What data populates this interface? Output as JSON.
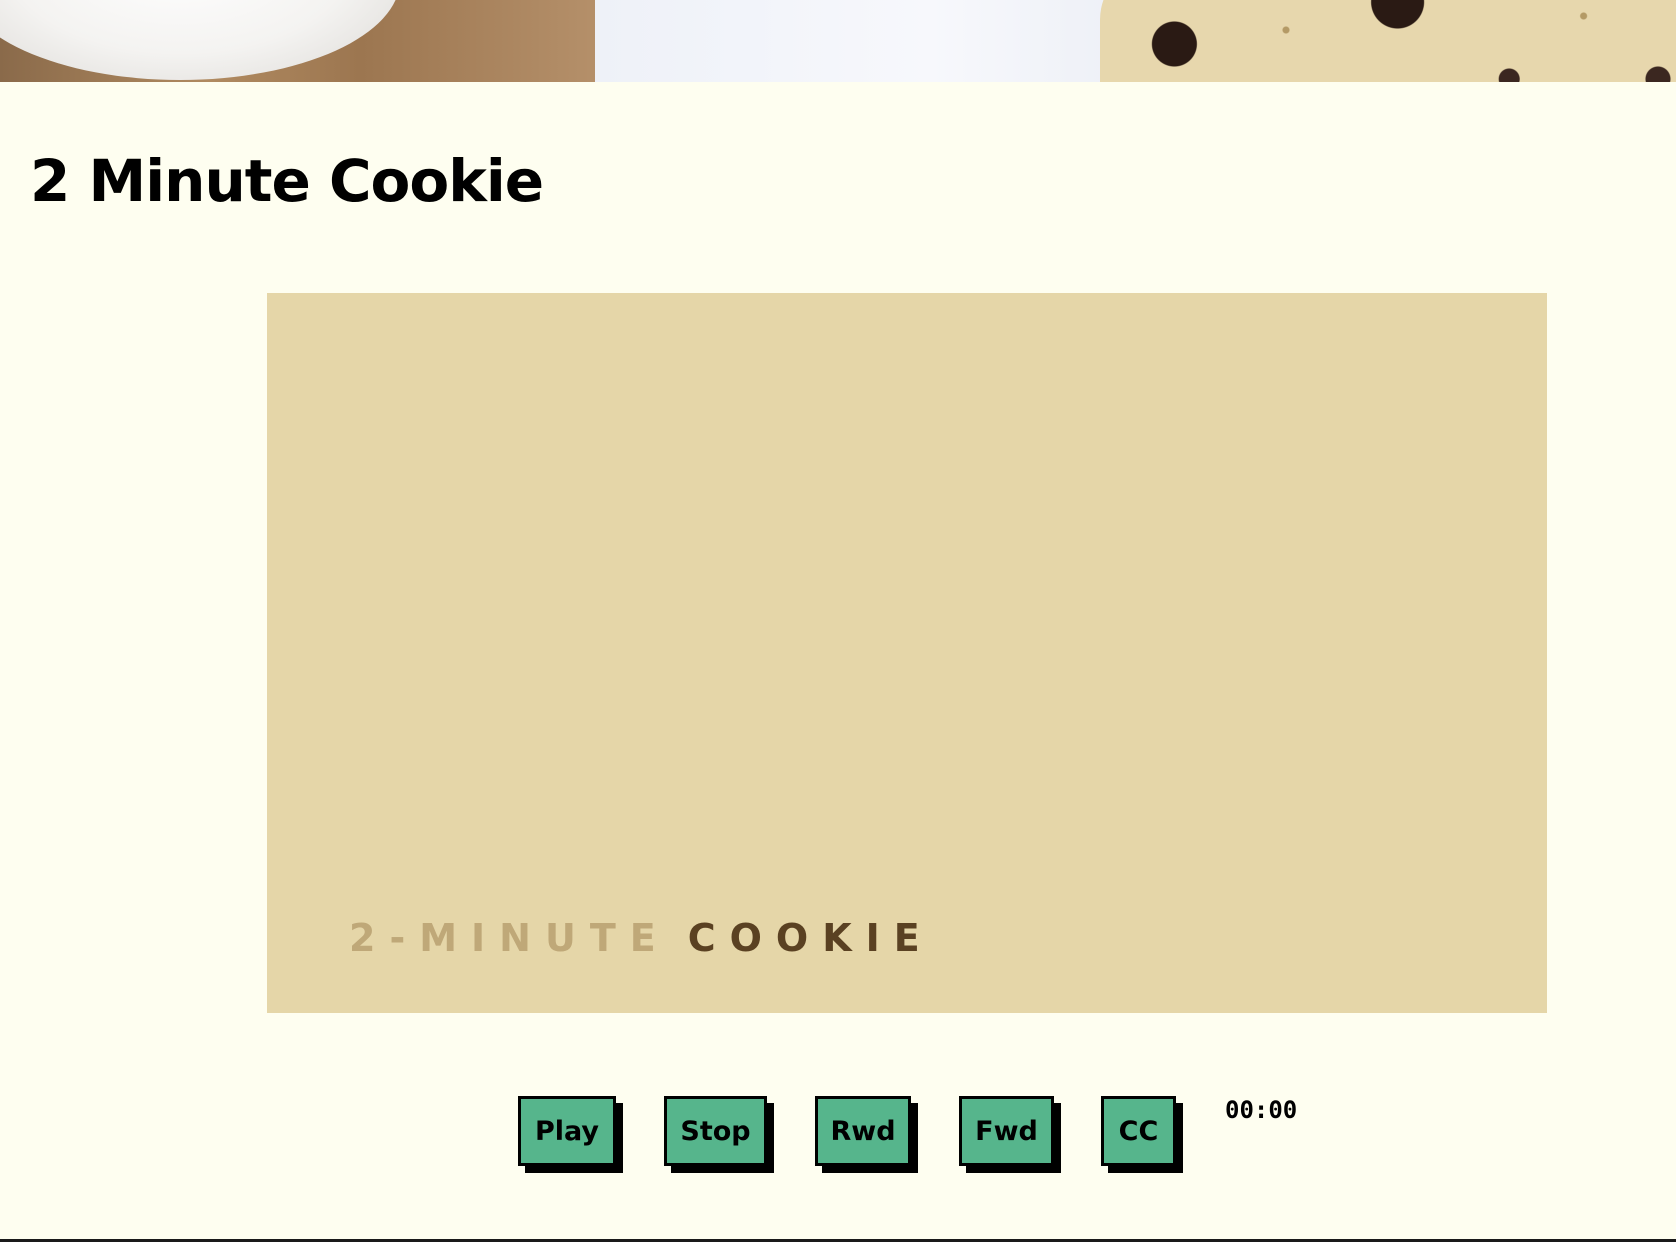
{
  "page": {
    "title": "2 Minute Cookie"
  },
  "video": {
    "caption_light": "2-MINUTE",
    "caption_dark": "COOKIE"
  },
  "controls": {
    "play_label": "Play",
    "stop_label": "Stop",
    "rwd_label": "Rwd",
    "fwd_label": "Fwd",
    "cc_label": "CC",
    "time": "00:00"
  },
  "colors": {
    "background": "#fefef0",
    "video_background": "#e5d6a8",
    "button": "#56b58c",
    "button_shadow": "#000000",
    "caption_light": "#bfa878",
    "caption_dark": "#5a4122"
  }
}
